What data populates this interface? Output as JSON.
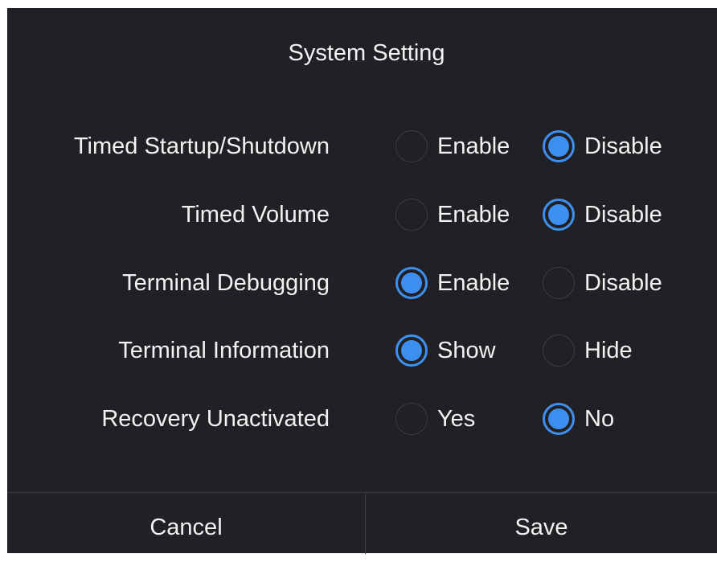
{
  "dialog": {
    "title": "System Setting",
    "rows": [
      {
        "label": "Timed Startup/Shutdown",
        "options": [
          {
            "label": "Enable",
            "checked": false
          },
          {
            "label": "Disable",
            "checked": true
          }
        ]
      },
      {
        "label": "Timed Volume",
        "options": [
          {
            "label": "Enable",
            "checked": false
          },
          {
            "label": "Disable",
            "checked": true
          }
        ]
      },
      {
        "label": "Terminal Debugging",
        "options": [
          {
            "label": "Enable",
            "checked": true
          },
          {
            "label": "Disable",
            "checked": false
          }
        ]
      },
      {
        "label": "Terminal Information",
        "options": [
          {
            "label": "Show",
            "checked": true
          },
          {
            "label": "Hide",
            "checked": false
          }
        ]
      },
      {
        "label": "Recovery Unactivated",
        "options": [
          {
            "label": "Yes",
            "checked": false
          },
          {
            "label": "No",
            "checked": true
          }
        ]
      }
    ],
    "footer": {
      "cancel_label": "Cancel",
      "save_label": "Save"
    }
  },
  "colors": {
    "background": "#212125",
    "accent": "#3d8ff0",
    "text": "#f2f2f2",
    "divider": "#3e3e44"
  }
}
